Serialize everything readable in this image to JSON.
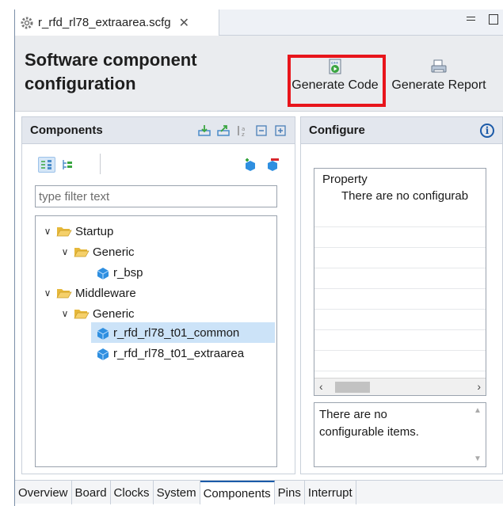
{
  "editor": {
    "tab_title": "r_rfd_rl78_extraarea.scfg",
    "close_glyph": "✕"
  },
  "header": {
    "title": "Software component configuration",
    "generate_code_label": "Generate Code",
    "generate_report_label": "Generate Report"
  },
  "components": {
    "title": "Components",
    "filter_placeholder": "type filter text",
    "tree": [
      {
        "label": "Startup",
        "kind": "folder"
      },
      {
        "label": "Generic",
        "kind": "folder"
      },
      {
        "label": "r_bsp",
        "kind": "component"
      },
      {
        "label": "Middleware",
        "kind": "folder"
      },
      {
        "label": "Generic",
        "kind": "folder"
      },
      {
        "label": "r_rfd_rl78_t01_common",
        "kind": "component",
        "selected": true
      },
      {
        "label": "r_rfd_rl78_t01_extraarea",
        "kind": "component"
      }
    ]
  },
  "configure": {
    "title": "Configure",
    "property_header": "Property",
    "property_message": "There are no configurab",
    "description": "There are no configurable items."
  },
  "bottom_tabs": [
    {
      "label": "Overview"
    },
    {
      "label": "Board"
    },
    {
      "label": "Clocks"
    },
    {
      "label": "System"
    },
    {
      "label": "Components",
      "active": true
    },
    {
      "label": "Pins"
    },
    {
      "label": "Interrupt"
    }
  ],
  "colors": {
    "highlight_border": "#e8151b",
    "selection": "#cce3f8",
    "folder": "#f0c44c",
    "cube": "#2f8fe0"
  }
}
